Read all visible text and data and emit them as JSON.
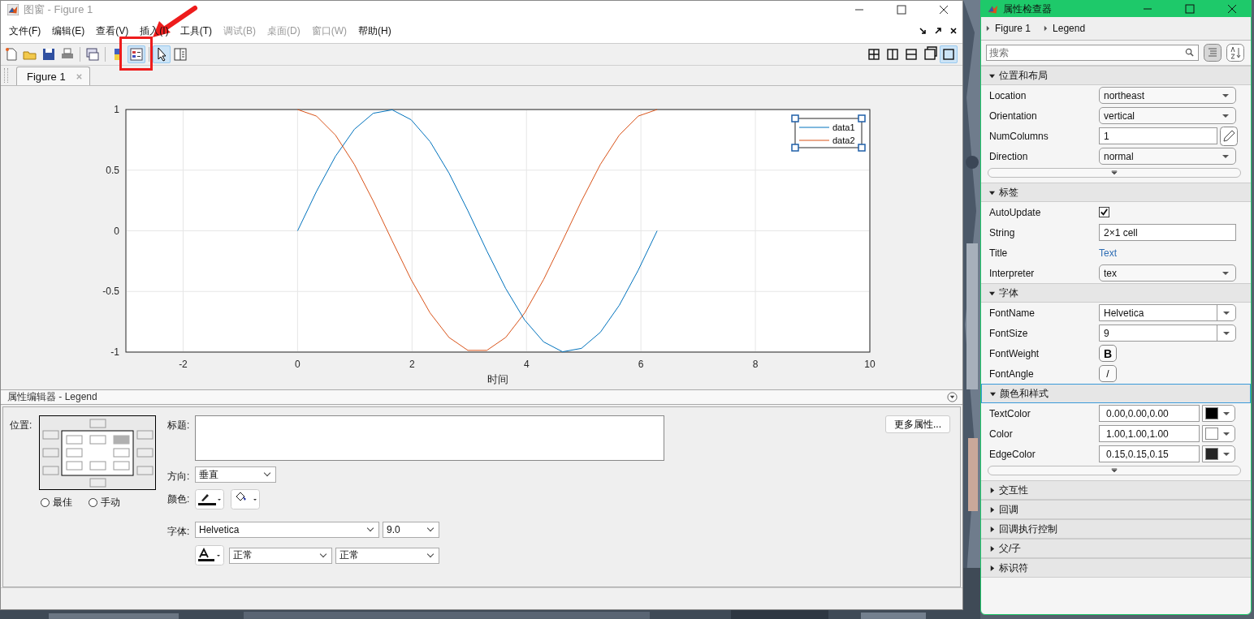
{
  "figure_window": {
    "title": "图窗 - Figure 1",
    "menu": [
      {
        "label": "文件(F)",
        "disabled": false
      },
      {
        "label": "编辑(E)",
        "disabled": false
      },
      {
        "label": "查看(V)",
        "disabled": false
      },
      {
        "label": "插入(I)",
        "disabled": false
      },
      {
        "label": "工具(T)",
        "disabled": false
      },
      {
        "label": "调试(B)",
        "disabled": true
      },
      {
        "label": "桌面(D)",
        "disabled": true
      },
      {
        "label": "窗口(W)",
        "disabled": true
      },
      {
        "label": "帮助(H)",
        "disabled": false
      }
    ],
    "toolbar": [
      {
        "kind": "new",
        "selected": false
      },
      {
        "kind": "open",
        "selected": false
      },
      {
        "kind": "save",
        "selected": false
      },
      {
        "kind": "print",
        "selected": false
      },
      {
        "kind": "sep"
      },
      {
        "kind": "link",
        "selected": false
      },
      {
        "kind": "sep"
      },
      {
        "kind": "colorbar",
        "selected": false
      },
      {
        "kind": "legend",
        "selected": true
      },
      {
        "kind": "sep"
      },
      {
        "kind": "pointer",
        "selected": true
      },
      {
        "kind": "panel",
        "selected": false
      }
    ],
    "layout_buttons": [
      {
        "kind": "grid",
        "selected": false
      },
      {
        "kind": "columns",
        "selected": false
      },
      {
        "kind": "rows",
        "selected": false
      },
      {
        "kind": "float",
        "selected": false
      },
      {
        "kind": "single",
        "selected": true
      }
    ],
    "tabs": [
      {
        "label": "Figure 1",
        "selected": true
      }
    ],
    "axes": {
      "legend_selected": true,
      "chart_data": {
        "type": "line",
        "grid": true,
        "legend": true,
        "xlabel": "时间",
        "xlim": [
          -3,
          10
        ],
        "ylim": [
          -1,
          1
        ],
        "xticks": [
          -2,
          0,
          2,
          4,
          6,
          8,
          10
        ],
        "yticks": [
          -1,
          -0.5,
          0,
          0.5,
          1
        ],
        "x": [
          0,
          0.331,
          0.661,
          0.992,
          1.323,
          1.653,
          1.984,
          2.315,
          2.646,
          2.976,
          3.307,
          3.638,
          3.968,
          4.299,
          4.63,
          4.96,
          5.291,
          5.622,
          5.952,
          6.283
        ],
        "series": [
          {
            "name": "data1",
            "color": "#0072bd",
            "values": [
              0,
              0.325,
              0.614,
              0.837,
              0.969,
              0.997,
              0.916,
              0.736,
              0.476,
              0.165,
              -0.165,
              -0.476,
              -0.736,
              -0.916,
              -0.997,
              -0.969,
              -0.837,
              -0.614,
              -0.325,
              0
            ]
          },
          {
            "name": "data2",
            "color": "#d95319",
            "values": [
              1,
              0.946,
              0.789,
              0.547,
              0.245,
              -0.083,
              -0.402,
              -0.677,
              -0.879,
              -0.986,
              -0.986,
              -0.879,
              -0.677,
              -0.402,
              -0.083,
              0.245,
              0.547,
              0.789,
              0.946,
              1
            ]
          }
        ]
      }
    },
    "property_editor": {
      "title": "属性编辑器 - Legend",
      "position_label": "位置:",
      "cells": [
        {
          "selected": false
        },
        {
          "selected": false
        },
        {
          "selected": false
        },
        {
          "selected": false
        },
        {
          "selected": false
        },
        {
          "selected": false
        },
        {
          "selected": false
        },
        {
          "selected": false
        },
        {
          "selected": false
        },
        {
          "selected": false
        },
        {
          "selected": true
        },
        {
          "selected": false
        },
        {
          "selected": false
        },
        {
          "selected": false
        },
        {
          "selected": false
        },
        {
          "selected": false
        }
      ],
      "radios": [
        {
          "label": "最佳",
          "selected": false
        },
        {
          "label": "手动",
          "selected": false
        }
      ],
      "title_label": "标题:",
      "direction_label": "方向:",
      "direction": "垂直",
      "color_label": "颜色:",
      "font_label": "字体:",
      "font_name": "Helvetica",
      "font_size": "9.0",
      "font_weight": "正常",
      "font_angle": "正常",
      "more_button": "更多属性..."
    }
  },
  "inspector": {
    "title": "属性检查器",
    "breadcrumbs": [
      "Figure 1",
      "Legend"
    ],
    "search": {
      "placeholder": "搜索"
    },
    "sections": [
      {
        "title": "位置和布局",
        "expanded": true,
        "selected": false,
        "has_more": true,
        "rows": [
          {
            "label": "Location",
            "kind": "dropdown",
            "value": "northeast"
          },
          {
            "label": "Orientation",
            "kind": "dropdown",
            "value": "vertical"
          },
          {
            "label": "NumColumns",
            "kind": "edit",
            "value": "1"
          },
          {
            "label": "Direction",
            "kind": "dropdown",
            "value": "normal"
          }
        ]
      },
      {
        "title": "标签",
        "expanded": true,
        "selected": false,
        "has_more": false,
        "rows": [
          {
            "label": "AutoUpdate",
            "kind": "checkbox",
            "checked": true
          },
          {
            "label": "String",
            "kind": "text",
            "value": "2×1 cell"
          },
          {
            "label": "Title",
            "kind": "link",
            "value": "Text"
          },
          {
            "label": "Interpreter",
            "kind": "dropdown",
            "value": "tex"
          }
        ]
      },
      {
        "title": "字体",
        "expanded": true,
        "selected": false,
        "has_more": false,
        "rows": [
          {
            "label": "FontName",
            "kind": "combo",
            "value": "Helvetica"
          },
          {
            "label": "FontSize",
            "kind": "combo",
            "value": "9"
          },
          {
            "label": "FontWeight",
            "kind": "toggle",
            "value": "B"
          },
          {
            "label": "FontAngle",
            "kind": "toggle",
            "value": "/"
          }
        ]
      },
      {
        "title": "颜色和样式",
        "expanded": true,
        "selected": true,
        "has_more": true,
        "rows": [
          {
            "label": "TextColor",
            "kind": "color",
            "value": "0.00,0.00,0.00",
            "color": "#000000"
          },
          {
            "label": "Color",
            "kind": "color",
            "value": "1.00,1.00,1.00",
            "color": "#ffffff"
          },
          {
            "label": "EdgeColor",
            "kind": "color",
            "value": "0.15,0.15,0.15",
            "color": "#262626"
          }
        ]
      },
      {
        "title": "交互性",
        "expanded": false,
        "selected": false
      },
      {
        "title": "回调",
        "expanded": false,
        "selected": false
      },
      {
        "title": "回调执行控制",
        "expanded": false,
        "selected": false
      },
      {
        "title": "父/子",
        "expanded": false,
        "selected": false
      },
      {
        "title": "标识符",
        "expanded": false,
        "selected": false
      }
    ]
  }
}
